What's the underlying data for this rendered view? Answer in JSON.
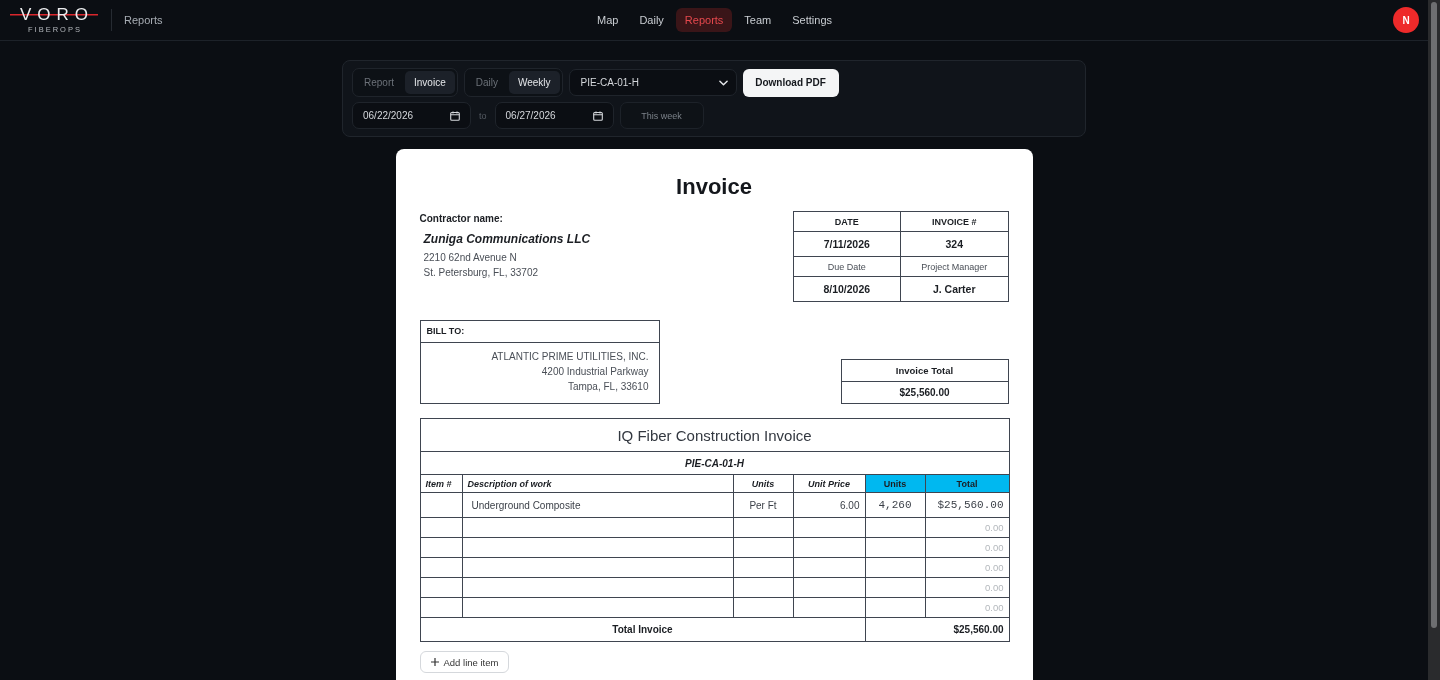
{
  "header": {
    "logo": {
      "wordmark": "VORO",
      "tagline": "FIBEROPS"
    },
    "section": "Reports",
    "nav": [
      {
        "label": "Map",
        "selected": false
      },
      {
        "label": "Daily",
        "selected": false
      },
      {
        "label": "Reports",
        "selected": true
      },
      {
        "label": "Team",
        "selected": false
      },
      {
        "label": "Settings",
        "selected": false
      }
    ],
    "avatar": "N"
  },
  "toolbar": {
    "mode_tabs": [
      {
        "label": "Report",
        "selected": false
      },
      {
        "label": "Invoice",
        "selected": true
      }
    ],
    "period_tabs": [
      {
        "label": "Daily",
        "selected": false
      },
      {
        "label": "Weekly",
        "selected": true
      }
    ],
    "project_select": "PIE-CA-01-H",
    "download_button": "Download PDF",
    "date_from": "06/22/2026",
    "range_separator": "to",
    "date_to": "06/27/2026",
    "preset_button": "This week"
  },
  "invoice": {
    "title": "Invoice",
    "contractor_label": "Contractor name:",
    "contractor_name": "Zuniga Communications LLC",
    "contractor_address": [
      "2210 62nd Avenue N",
      "St. Petersburg, FL, 33702"
    ],
    "meta": [
      {
        "kind": "header",
        "cells": [
          "DATE",
          "INVOICE #"
        ]
      },
      {
        "kind": "value",
        "cells": [
          "7/11/2026",
          "324"
        ]
      },
      {
        "kind": "label",
        "cells": [
          "Due Date",
          "Project Manager"
        ]
      },
      {
        "kind": "value",
        "cells": [
          "8/10/2026",
          "J. Carter"
        ]
      }
    ],
    "bill_to": {
      "label": "BILL TO:",
      "lines": [
        "ATLANTIC PRIME UTILITIES, INC.",
        "4200 Industrial Parkway",
        "Tampa, FL, 33610"
      ]
    },
    "invoice_total": {
      "label": "Invoice Total",
      "value": "$25,560.00"
    },
    "line_items": {
      "title": "IQ Fiber Construction Invoice",
      "project": "PIE-CA-01-H",
      "columns": [
        {
          "label": "Item #",
          "highlighted": false
        },
        {
          "label": "Description of work",
          "highlighted": false
        },
        {
          "label": "Units",
          "highlighted": false
        },
        {
          "label": "Unit Price",
          "highlighted": false
        },
        {
          "label": "Units",
          "highlighted": true
        },
        {
          "label": "Total",
          "highlighted": true
        }
      ],
      "rows": [
        {
          "kind": "entry",
          "description": "Underground Composite",
          "unit": "Per Ft",
          "unit_price": "6.00",
          "units": "4,260",
          "total": "$25,560.00"
        },
        {
          "kind": "blank",
          "total": "0.00"
        },
        {
          "kind": "blank",
          "total": "0.00"
        },
        {
          "kind": "blank",
          "total": "0.00"
        },
        {
          "kind": "blank",
          "total": "0.00"
        },
        {
          "kind": "blank",
          "total": "0.00"
        }
      ],
      "total_label": "Total Invoice",
      "total_value": "$25,560.00"
    },
    "add_button": "Add line item"
  }
}
